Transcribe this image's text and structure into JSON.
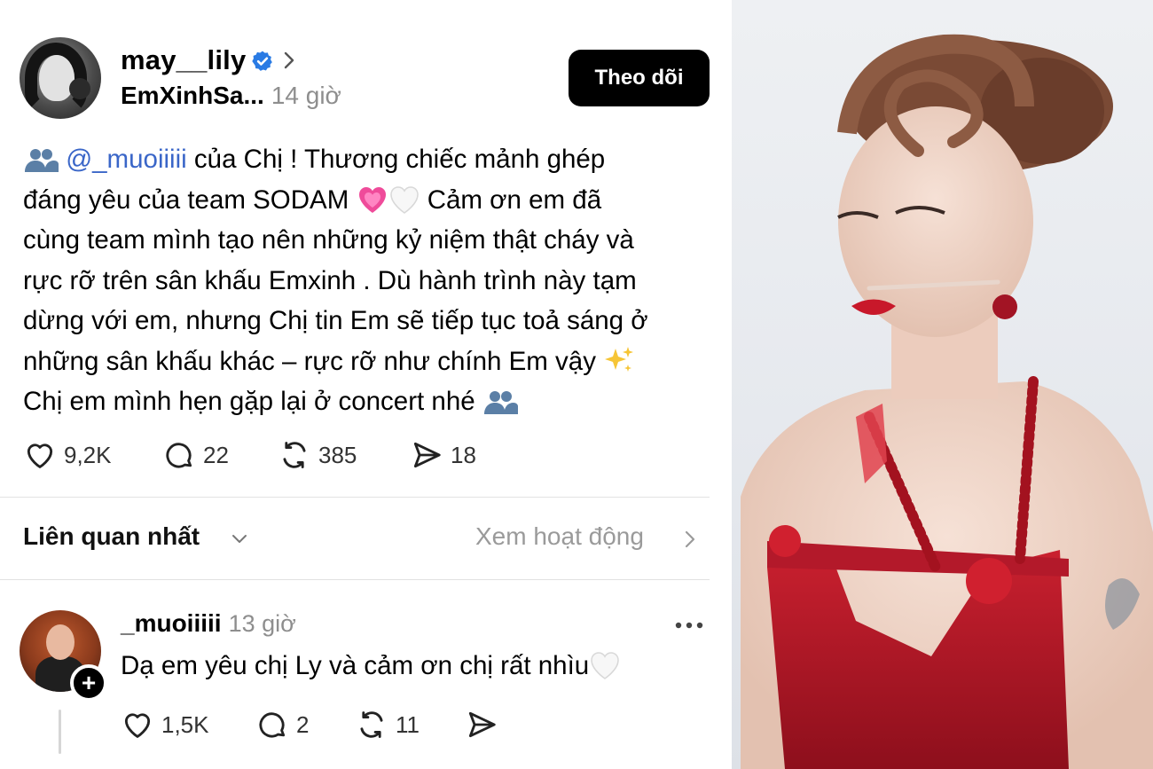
{
  "post": {
    "username": "may__lily",
    "subtitle": "EmXinhSa...",
    "time": "14 giờ",
    "follow_label": "Theo dõi",
    "text": {
      "mention": "@_muoiiiii",
      "line1_rest": " của Chị ! Thương chiếc mảnh ghép",
      "line2_a": "đáng yêu của team SODAM ",
      "line2_b": " Cảm ơn em đã",
      "line3": "cùng team mình tạo nên những kỷ niệm thật cháy và",
      "line4": "rực rỡ trên sân khấu Emxinh . Dù hành trình này tạm",
      "line5": "dừng với em, nhưng Chị tin Em sẽ tiếp tục toả sáng ở",
      "line6": "những sân khấu khác – rực rỡ như chính Em vậy ",
      "line7": "Chị em mình hẹn gặp lại ở concert nhé "
    },
    "likes": "9,2K",
    "comments": "22",
    "reposts": "385",
    "shares": "18"
  },
  "sort": {
    "label": "Liên quan nhất",
    "activity_link": "Xem hoạt động"
  },
  "reply": {
    "username": "_muoiiiii",
    "time": "13 giờ",
    "text": "Dạ em yêu chị Ly và cảm ơn chị rất nhìu",
    "likes": "1,5K",
    "comments": "2",
    "reposts": "11",
    "plus": "+"
  },
  "colors": {
    "mention": "#3a66c8",
    "verified": "#2a7be4",
    "muted": "#8e8e8e",
    "button": "#000000",
    "dress": "#c01a2a"
  },
  "icons": [
    "verified-badge-icon",
    "chevron-right-icon",
    "heart-icon",
    "comment-icon",
    "repost-icon",
    "share-icon",
    "chevron-down-icon",
    "more-icon",
    "people-emoji-icon",
    "growing-heart-emoji-icon",
    "white-heart-emoji-icon",
    "sparkles-emoji-icon"
  ]
}
